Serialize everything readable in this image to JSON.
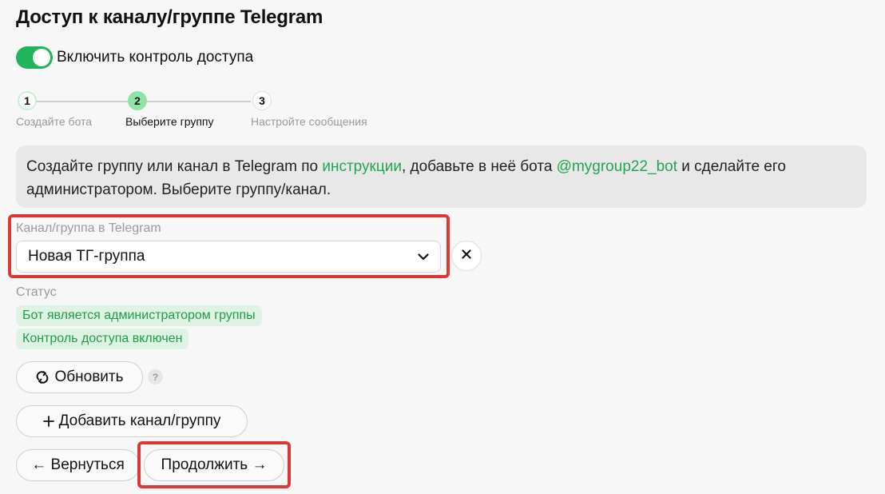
{
  "page": {
    "title": "Доступ к каналу/группе Telegram"
  },
  "access_toggle": {
    "label": "Включить контроль доступа",
    "state": "on"
  },
  "stepper": {
    "steps": [
      {
        "number": "1",
        "label": "Создайте бота",
        "state": "done"
      },
      {
        "number": "2",
        "label": "Выберите группу",
        "state": "active"
      },
      {
        "number": "3",
        "label": "Настройте сообщения",
        "state": "upcoming"
      }
    ]
  },
  "info": {
    "text_1": "Создайте группу или канал в Telegram по ",
    "link_instructions": "инструкции",
    "text_2": ", добавьте в неё бота ",
    "link_bot": "@mygroup22_bot",
    "text_3": " и сделайте его администратором. Выберите группу/канал."
  },
  "channel_field": {
    "label": "Канал/группа в Telegram",
    "value": "Новая ТГ-группа"
  },
  "status": {
    "label": "Статус",
    "badges": [
      "Бот является администратором группы",
      "Контроль доступа включен"
    ]
  },
  "buttons": {
    "refresh": "Обновить",
    "help": "?",
    "add_channel": "Добавить канал/группу",
    "back": "← Вернуться",
    "continue": "Продолжить →"
  },
  "colors": {
    "accent": "#22b45a",
    "link": "#22a552",
    "highlight": "#d83a35",
    "badge_bg": "#dff3e4"
  }
}
